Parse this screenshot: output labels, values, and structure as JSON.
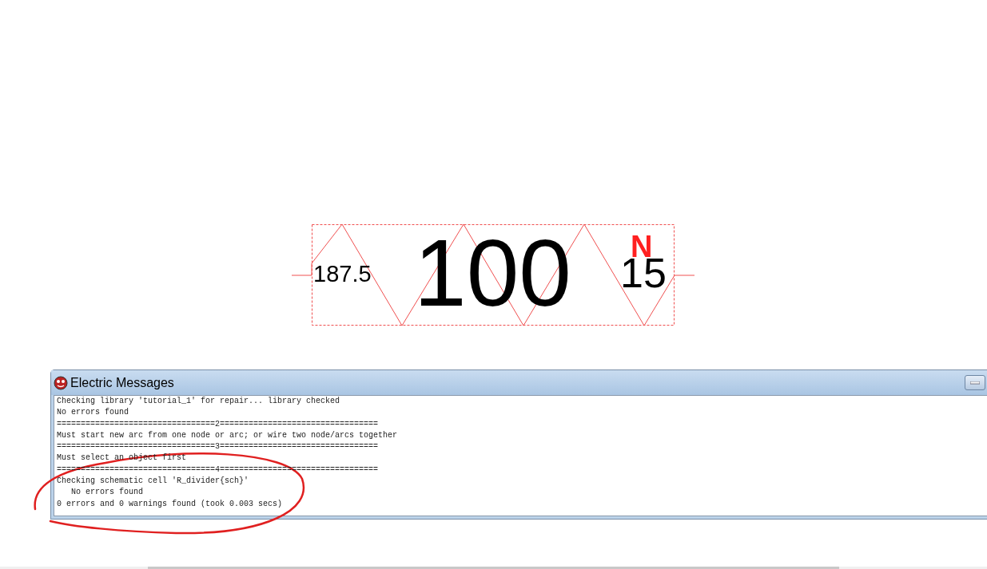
{
  "schematic": {
    "left_label": "187.5",
    "value_label": "100",
    "right_label": "15",
    "marker": "N"
  },
  "messages_window": {
    "title": "Electric Messages",
    "lines": [
      "Checking library 'tutorial_1' for repair... library checked",
      "No errors found",
      "=================================2=================================",
      "Must start new arc from one node or arc; or wire two node/arcs together",
      "=================================3=================================",
      "Must select an object first",
      "=================================4=================================",
      "Checking schematic cell 'R_divider{sch}'",
      "   No errors found",
      "0 errors and 0 warnings found (took 0.003 secs)"
    ]
  }
}
